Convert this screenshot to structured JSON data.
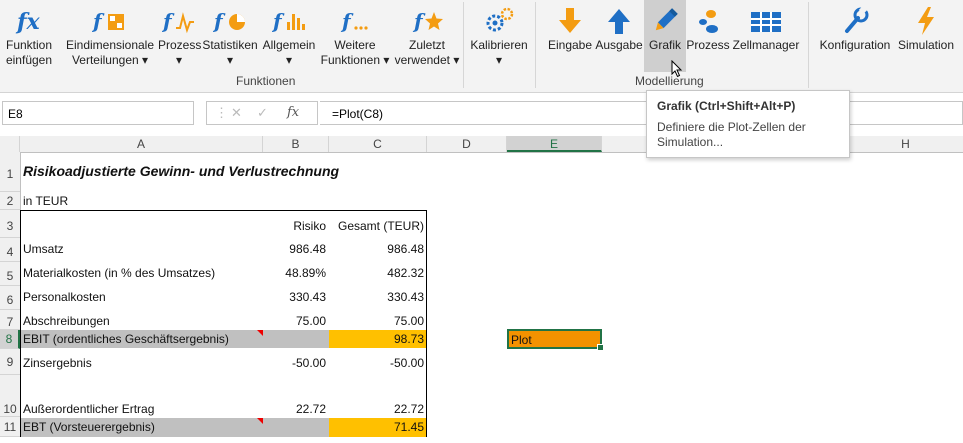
{
  "ribbon": {
    "funktionen_buttons": [
      {
        "line1": "Funktion",
        "line2": "einfügen",
        "icon": "fx-icon"
      },
      {
        "line1": "Eindimensionale",
        "line2": "Verteilungen ▾",
        "icon": "distribution-cube-icon"
      },
      {
        "line1": "Prozess",
        "line2": "▾",
        "icon": "process-fx-icon"
      },
      {
        "line1": "Statistiken",
        "line2": "▾",
        "icon": "statistics-fx-icon"
      },
      {
        "line1": "Allgemein",
        "line2": "▾",
        "icon": "general-fx-icon"
      },
      {
        "line1": "Weitere",
        "line2": "Funktionen ▾",
        "icon": "more-functions-icon"
      },
      {
        "line1": "Zuletzt",
        "line2": "verwendet ▾",
        "icon": "recent-star-icon"
      }
    ],
    "kalibrieren": {
      "line1": "Kalibrieren",
      "line2": "▾",
      "icon": "gears-icon"
    },
    "group_funktionen": "Funktionen",
    "modellierung_buttons": [
      {
        "label": "Eingabe",
        "icon": "input-arrow-down-icon"
      },
      {
        "label": "Ausgabe",
        "icon": "output-arrow-up-icon"
      },
      {
        "label": "Grafik",
        "icon": "pencil-icon"
      },
      {
        "label": "Prozess",
        "icon": "process-dots-icon"
      },
      {
        "label": "Zellmanager",
        "icon": "cell-grid-icon"
      }
    ],
    "group_modellierung": "Modellierung",
    "config_buttons": [
      {
        "label": "Konfiguration",
        "icon": "wrench-icon"
      },
      {
        "label": "Simulation",
        "icon": "lightning-icon"
      }
    ]
  },
  "formula_bar": {
    "name_box": "E8",
    "cancel": "✕",
    "enter": "✓",
    "fx": "fx",
    "formula": "=Plot(C8)"
  },
  "tooltip": {
    "title": "Grafik (Ctrl+Shift+Alt+P)",
    "description": "Definiere die Plot-Zellen der Simulation..."
  },
  "columns": [
    "A",
    "B",
    "C",
    "D",
    "E",
    "H"
  ],
  "rows": [
    "1",
    "2",
    "3",
    "4",
    "5",
    "6",
    "7",
    "8",
    "9",
    "10",
    "11"
  ],
  "sheet": {
    "title": "Risikoadjustierte Gewinn- und Verlustrechnung",
    "unit": "in TEUR",
    "header_risk": "Risiko",
    "header_total": "Gesamt (TEUR)",
    "lines": [
      {
        "label": "Umsatz",
        "risk": "986.48",
        "total": "986.48"
      },
      {
        "label": "Materialkosten (in % des Umsatzes)",
        "risk": "48.89%",
        "total": "482.32"
      },
      {
        "label": "Personalkosten",
        "risk": "330.43",
        "total": "330.43"
      },
      {
        "label": "Abschreibungen",
        "risk": "75.00",
        "total": "75.00"
      },
      {
        "label": " EBIT (ordentliches Geschäftsergebnis)",
        "risk": "",
        "total": "98.73"
      },
      {
        "label": "Zinsergebnis",
        "risk": "-50.00",
        "total": "-50.00"
      },
      {
        "label": "Außerordentlicher Ertrag",
        "risk": "22.72",
        "total": "22.72"
      },
      {
        "label": "EBT (Vorsteuerergebnis)",
        "risk": "",
        "total": "71.45"
      }
    ],
    "plot_cell": "Plot"
  },
  "colors": {
    "orange": "#f39c12",
    "blue": "#1f6fc5",
    "yellow": "#ffc000",
    "gray_row": "#c0c0c0",
    "plot_fill": "#f39200",
    "excel_green": "#217346"
  }
}
